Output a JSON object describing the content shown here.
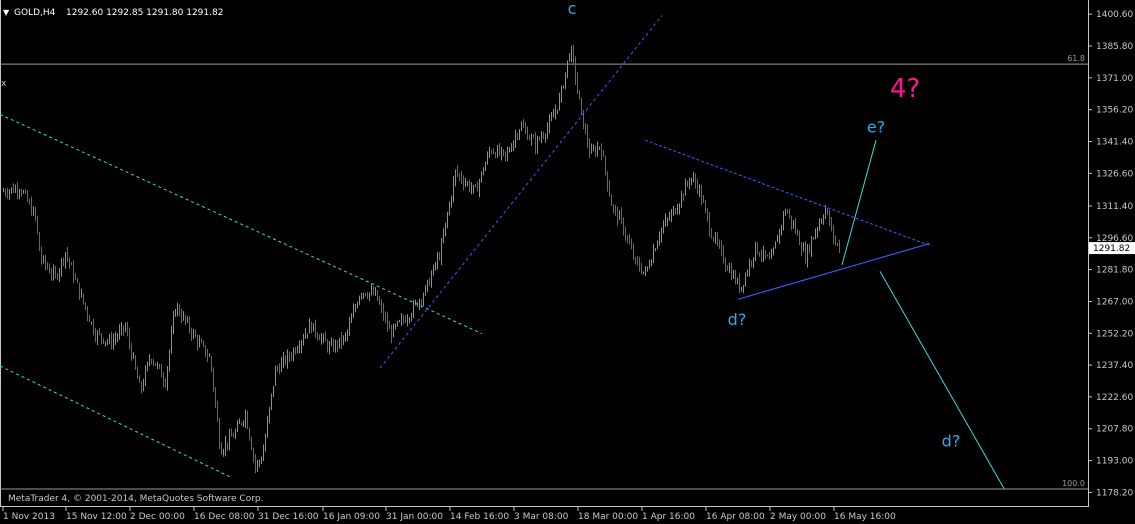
{
  "header": {
    "menu_glyph": "▼",
    "symbol": "GOLD,H4",
    "ohlc": "1292.60 1292.85 1291.80 1291.82"
  },
  "footer": {
    "copyright": "MetaTrader 4, © 2001-2014, MetaQuotes Software Corp."
  },
  "chart_data": {
    "type": "candlestick",
    "symbol": "GOLD",
    "timeframe": "H4",
    "last_price": "1291.82",
    "ylim": [
      1171.4,
      1407.2
    ],
    "y_ticks": [
      "1400.60",
      "1385.80",
      "1371.00",
      "1356.20",
      "1341.40",
      "1326.60",
      "1311.40",
      "1296.60",
      "1281.80",
      "1267.00",
      "1252.20",
      "1237.40",
      "1222.60",
      "1207.80",
      "1193.00",
      "1178.20"
    ],
    "x_ticks": [
      "1 Nov 2013",
      "15 Nov 12:00",
      "2 Dec 00:00",
      "16 Dec 08:00",
      "31 Dec 16:00",
      "16 Jan 09:00",
      "31 Jan 00:00",
      "14 Feb 16:00",
      "3 Mar 08:00",
      "18 Mar 00:00",
      "1 Apr 16:00",
      "16 Apr 08:00",
      "2 May 00:00",
      "16 May 16:00"
    ],
    "price_path": [
      [
        0,
        1318
      ],
      [
        20,
        1320
      ],
      [
        35,
        1306
      ],
      [
        40,
        1287
      ],
      [
        55,
        1278
      ],
      [
        65,
        1290
      ],
      [
        80,
        1270
      ],
      [
        95,
        1252
      ],
      [
        110,
        1248
      ],
      [
        125,
        1255
      ],
      [
        140,
        1225
      ],
      [
        150,
        1242
      ],
      [
        165,
        1230
      ],
      [
        175,
        1265
      ],
      [
        195,
        1250
      ],
      [
        210,
        1240
      ],
      [
        220,
        1198
      ],
      [
        235,
        1206
      ],
      [
        245,
        1215
      ],
      [
        255,
        1190
      ],
      [
        262,
        1195
      ],
      [
        275,
        1235
      ],
      [
        290,
        1242
      ],
      [
        310,
        1256
      ],
      [
        330,
        1245
      ],
      [
        345,
        1250
      ],
      [
        360,
        1272
      ],
      [
        375,
        1270
      ],
      [
        390,
        1252
      ],
      [
        410,
        1262
      ],
      [
        425,
        1272
      ],
      [
        440,
        1290
      ],
      [
        455,
        1327
      ],
      [
        475,
        1318
      ],
      [
        490,
        1338
      ],
      [
        505,
        1334
      ],
      [
        520,
        1349
      ],
      [
        535,
        1340
      ],
      [
        550,
        1350
      ],
      [
        560,
        1362
      ],
      [
        570,
        1385
      ],
      [
        575,
        1372
      ],
      [
        580,
        1356
      ],
      [
        590,
        1335
      ],
      [
        600,
        1340
      ],
      [
        612,
        1310
      ],
      [
        620,
        1305
      ],
      [
        635,
        1285
      ],
      [
        645,
        1280
      ],
      [
        660,
        1300
      ],
      [
        675,
        1310
      ],
      [
        690,
        1325
      ],
      [
        698,
        1320
      ],
      [
        710,
        1300
      ],
      [
        725,
        1285
      ],
      [
        740,
        1273
      ],
      [
        755,
        1292
      ],
      [
        770,
        1285
      ],
      [
        785,
        1310
      ],
      [
        795,
        1300
      ],
      [
        805,
        1288
      ],
      [
        815,
        1300
      ],
      [
        825,
        1310
      ],
      [
        835,
        1294
      ],
      [
        840,
        1292
      ]
    ],
    "horizontal_levels": [
      {
        "label": "61.8",
        "price": 1377.4
      },
      {
        "label": "100.0",
        "price": 1179.8
      }
    ],
    "wave_labels": [
      {
        "text": "c",
        "color": "#20b0f0",
        "x": 572,
        "price": 1400.8
      },
      {
        "text": "4?",
        "color": "#ff1493",
        "x": 905,
        "price": 1362
      },
      {
        "text": "e?",
        "color": "#20b0f0",
        "x": 876,
        "price": 1345.6
      },
      {
        "text": "d?",
        "color": "#20b0f0",
        "x": 737,
        "price": 1256
      },
      {
        "text": "d?",
        "color": "#20b0f0",
        "x": 951,
        "price": 1199.6
      }
    ],
    "trendlines": [
      {
        "style": "channel",
        "p1": [
          0,
          1354
        ],
        "p2": [
          482,
          1252
        ]
      },
      {
        "style": "channel",
        "p1": [
          0,
          1237
        ],
        "p2": [
          232,
          1185
        ]
      },
      {
        "style": "trend",
        "p1": [
          380,
          1236
        ],
        "p2": [
          662,
          1400
        ]
      },
      {
        "style": "triangle",
        "p1": [
          645,
          1342
        ],
        "p2": [
          930,
          1293
        ]
      },
      {
        "style": "triangle",
        "p1": [
          738,
          1268
        ],
        "p2": [
          930,
          1294
        ]
      },
      {
        "style": "projection",
        "p1": [
          842,
          1284
        ],
        "p2": [
          876,
          1342
        ]
      },
      {
        "style": "projection",
        "p1": [
          880,
          1281
        ],
        "p2": [
          1004,
          1180
        ]
      }
    ]
  }
}
